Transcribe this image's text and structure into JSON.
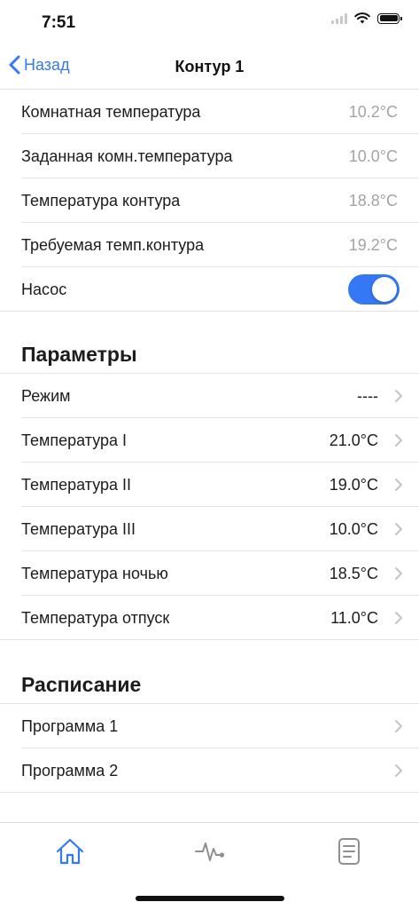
{
  "status": {
    "time": "7:51"
  },
  "nav": {
    "back_label": "Назад",
    "title": "Контур 1"
  },
  "info_rows": [
    {
      "label": "Комнатная температура",
      "value": "10.2°C"
    },
    {
      "label": "Заданная комн.температура",
      "value": "10.0°C"
    },
    {
      "label": "Температура контура",
      "value": "18.8°C"
    },
    {
      "label": "Требуемая темп.контура",
      "value": "19.2°C"
    }
  ],
  "pump": {
    "label": "Насос",
    "enabled": true
  },
  "parameters": {
    "header": "Параметры",
    "rows": [
      {
        "label": "Режим",
        "value": "----"
      },
      {
        "label": "Температура I",
        "value": "21.0°C"
      },
      {
        "label": "Температура II",
        "value": "19.0°C"
      },
      {
        "label": "Температура III",
        "value": "10.0°C"
      },
      {
        "label": "Температура ночью",
        "value": "18.5°C"
      },
      {
        "label": "Температура отпуск",
        "value": "11.0°C"
      }
    ]
  },
  "schedule": {
    "header": "Расписание",
    "rows": [
      {
        "label": "Программа 1"
      },
      {
        "label": "Программа 2"
      }
    ]
  },
  "tabs": [
    {
      "icon": "home-icon",
      "active": true
    },
    {
      "icon": "activity-icon",
      "active": false
    },
    {
      "icon": "document-icon",
      "active": false
    }
  ],
  "colors": {
    "accent": "#3478f6",
    "muted_value": "#a3a3a8",
    "separator": "#e4e4e7"
  }
}
